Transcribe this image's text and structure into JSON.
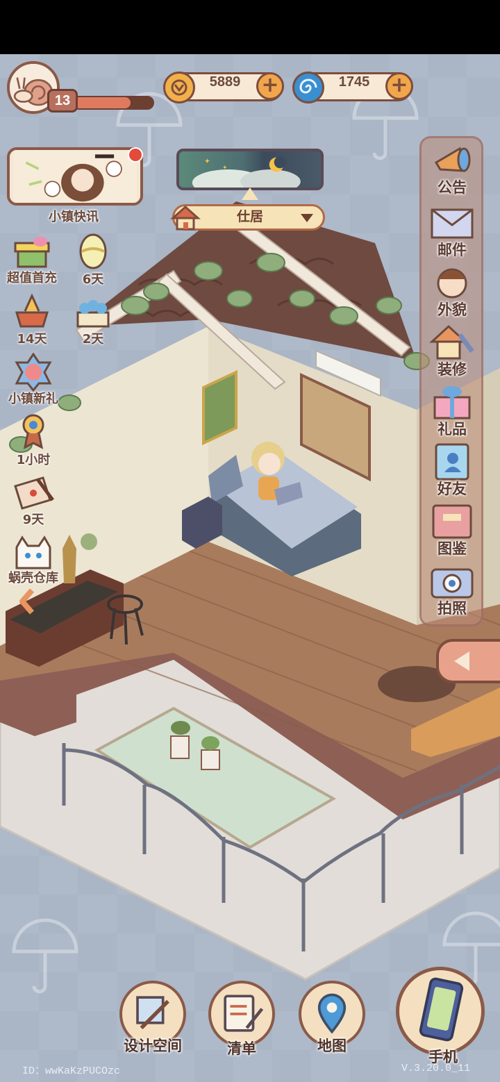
{
  "player": {
    "level": "13",
    "xp_fraction": 0.72
  },
  "currency": [
    {
      "name": "coins",
      "value": "5889",
      "icon": "coin-icon",
      "color": "#f2b04b"
    },
    {
      "name": "shells",
      "value": "1745",
      "icon": "spiral-icon",
      "color": "#3a8fd1"
    }
  ],
  "news": {
    "label": "小镇快讯"
  },
  "left_menu": [
    {
      "label": "超值首充",
      "icon": "gift-box-icon"
    },
    {
      "label": "6天",
      "icon": "egg-icon"
    },
    {
      "label": "14天",
      "icon": "trophy-icon"
    },
    {
      "label": "2天",
      "icon": "flower-basket-icon"
    },
    {
      "label": "小镇新礼",
      "icon": "rose-badge-icon"
    },
    {
      "label": "1小时",
      "icon": "medal-icon"
    },
    {
      "label": "9天",
      "icon": "envelope-icon"
    },
    {
      "label": "蜗壳仓库",
      "icon": "cat-warehouse-icon"
    }
  ],
  "location": {
    "name": "仕居"
  },
  "right_menu": [
    {
      "label": "公告",
      "icon": "megaphone-icon"
    },
    {
      "label": "邮件",
      "icon": "mail-icon"
    },
    {
      "label": "外貌",
      "icon": "face-icon"
    },
    {
      "label": "装修",
      "icon": "house-wrench-icon"
    },
    {
      "label": "礼品",
      "icon": "present-icon"
    },
    {
      "label": "好友",
      "icon": "contacts-icon"
    },
    {
      "label": "图鉴",
      "icon": "album-icon"
    },
    {
      "label": "拍照",
      "icon": "camera-icon"
    }
  ],
  "bottom_nav": [
    {
      "label": "设计空间",
      "icon": "design-icon"
    },
    {
      "label": "清单",
      "icon": "checklist-icon"
    },
    {
      "label": "地图",
      "icon": "map-pin-icon"
    },
    {
      "label": "手机",
      "icon": "phone-icon"
    }
  ],
  "footer": {
    "id": "ID：wwKaKzPUCOzc",
    "version": "V.3.20.0_11"
  }
}
